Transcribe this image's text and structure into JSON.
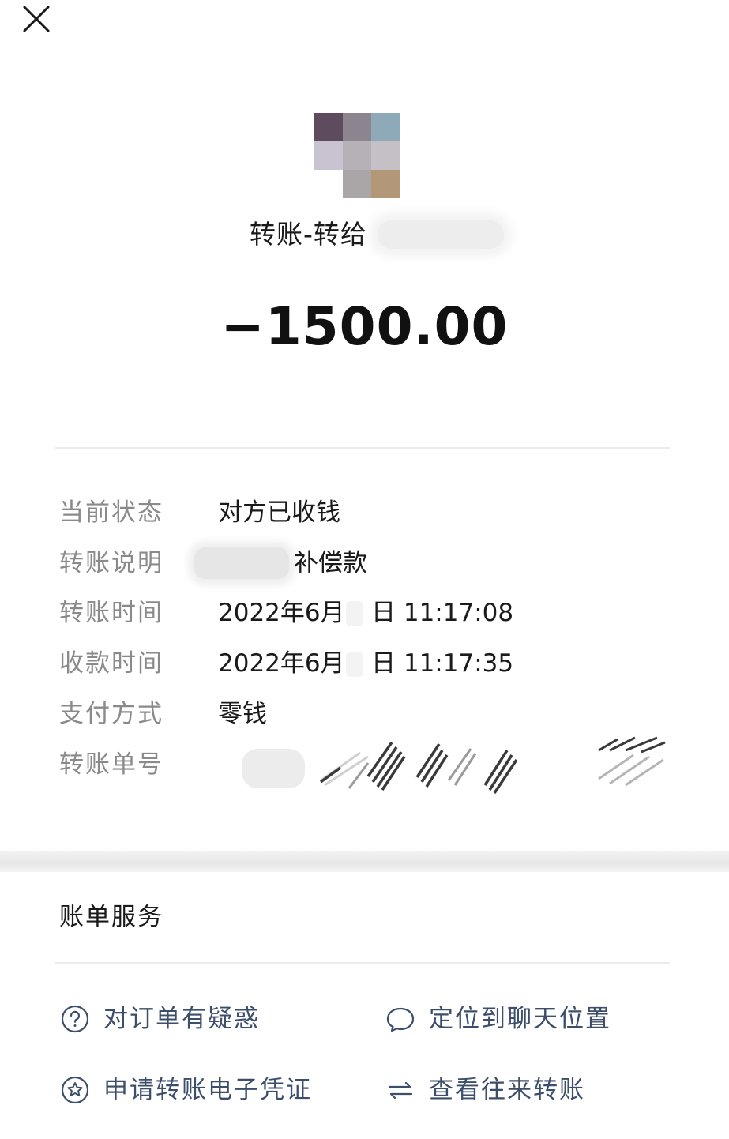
{
  "header": {
    "close_icon": "close-icon"
  },
  "transfer": {
    "title": "转账-转给",
    "amount": "−1500.00"
  },
  "details": [
    {
      "label": "当前状态",
      "value": "对方已收钱"
    },
    {
      "label": "转账说明",
      "value": "补偿款"
    },
    {
      "label": "转账时间",
      "value": "2022年6月",
      "value_suffix": "日 11:17:08"
    },
    {
      "label": "收款时间",
      "value": "2022年6月",
      "value_suffix": "日 11:17:35"
    },
    {
      "label": "支付方式",
      "value": "零钱"
    },
    {
      "label": "转账单号",
      "value": ""
    }
  ],
  "services": {
    "title": "账单服务",
    "items": [
      {
        "label": "对订单有疑惑",
        "icon": "question-icon"
      },
      {
        "label": "定位到聊天位置",
        "icon": "chat-bubble-icon"
      },
      {
        "label": "申请转账电子凭证",
        "icon": "star-badge-icon"
      },
      {
        "label": "查看往来转账",
        "icon": "exchange-arrows-icon"
      }
    ]
  },
  "colors": {
    "link": "#3d4e6b",
    "label_gray": "#8a8a8a",
    "text": "#1a1a1a"
  }
}
